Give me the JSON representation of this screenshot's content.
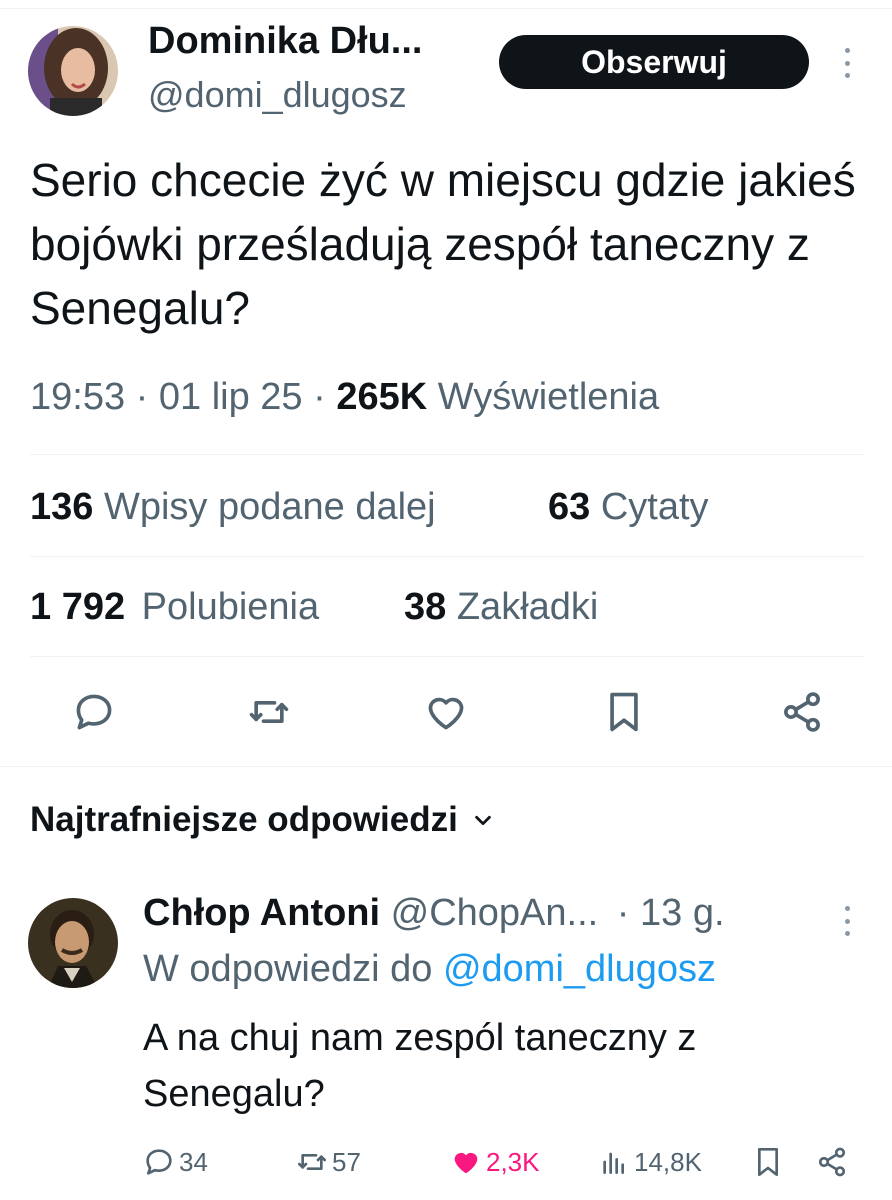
{
  "tweet": {
    "author_name": "Dominika Dłu...",
    "author_handle": "@domi_dlugosz",
    "follow_label": "Obserwuj",
    "text": "Serio chcecie żyć w miejscu gdzie jakieś bojówki prześladują zespół taneczny z Senegalu?",
    "time": "19:53",
    "date": "01 lip 25",
    "views_count": "265K",
    "views_label": "Wyświetlenia",
    "separator": "·",
    "stats": {
      "retweets_count": "136",
      "retweets_label": "Wpisy podane dalej",
      "quotes_count": "63",
      "quotes_label": "Cytaty",
      "likes_count": "1 792",
      "likes_label": "Polubienia",
      "bookmarks_count": "38",
      "bookmarks_label": "Zakładki"
    },
    "actions": [
      "reply-icon",
      "retweet-icon",
      "like-icon",
      "bookmark-icon",
      "share-icon"
    ]
  },
  "replies_section": {
    "title": "Najtrafniejsze odpowiedzi",
    "icon": "chevron-down-icon"
  },
  "reply": {
    "author_name": "Chłop Antoni",
    "author_handle": "@ChopAn...",
    "time": "· 13 g.",
    "reply_to_label": "W odpowiedzi do",
    "reply_to_handle": "@domi_dlugosz",
    "text": "A na chuj nam zespól taneczny z Senegalu?",
    "actions": {
      "replies": "34",
      "retweets": "57",
      "likes": "2,3K",
      "views": "14,8K"
    }
  },
  "colors": {
    "text": "#0f1419",
    "secondary": "#536471",
    "link": "#1d9bf0",
    "like_active": "#f91880",
    "follow_bg": "#0f1419",
    "divider": "#eff3f4"
  }
}
